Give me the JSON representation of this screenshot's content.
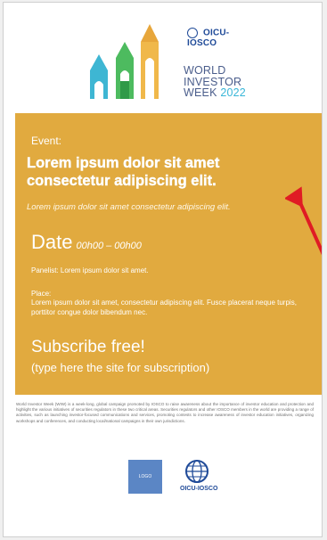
{
  "header": {
    "top_logo_text": "OICU-IOSCO",
    "wordmark_line1": "WORLD",
    "wordmark_line2": "INVESTOR",
    "wordmark_line3": "WEEK",
    "wordmark_year": "2022"
  },
  "event_panel": {
    "event_label": "Event:",
    "title": "Lorem ipsum dolor sit amet consectetur adipiscing elit.",
    "subtitle": "Lorem ipsum dolor sit amet consectetur adipiscing elit.",
    "date_label": "Date",
    "date_value": "00h00 – 00h00",
    "panelist": "Panelist: Lorem ipsum dolor sit amet.",
    "place_label": "Place:",
    "place_text": "Lorem ipsum dolor sit amet, consectetur adipiscing elit. Fusce placerat neque turpis, porttitor congue dolor bibendum nec.",
    "subscribe": "Subscribe free!",
    "subscribe_note": "(type here the site for subscription)"
  },
  "description": "World Investor Week (WIW) is a week-long, global campaign promoted by IOSCO to raise awareness about the importance of investor education and protection and highlight the various initiatives of securities regulators in these two critical areas. Securities regulators and other IOSCO members in the world are providing a range of activities, such as launching investor-focused communications and services, promoting contests to increase awareness of investor education initiatives, organizing workshops and conferences, and conducting local/national campaigns in their own jurisdictions.",
  "footer": {
    "logo_placeholder": "LOGO",
    "iosco_text": "OICU-IOSCO"
  },
  "colors": {
    "panel": "#e1aa3f",
    "accent_blue": "#38b6d8",
    "accent_green": "#4dbb5f",
    "arrow": "#e01b24"
  }
}
